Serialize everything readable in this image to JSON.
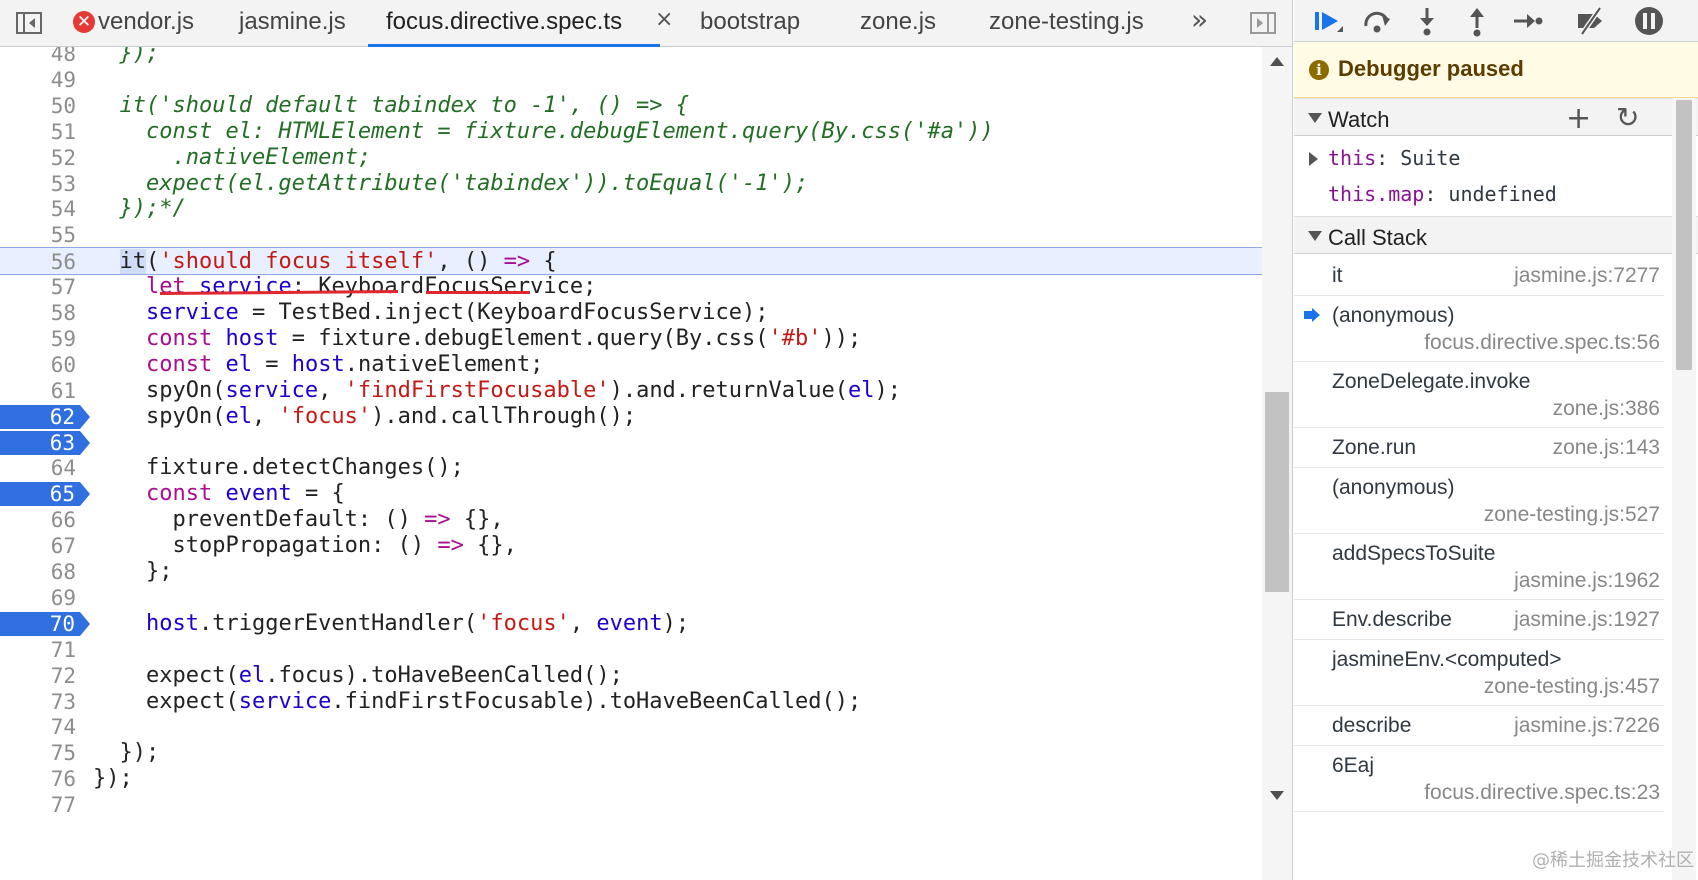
{
  "tabs": [
    {
      "label": "vendor.js",
      "error": true
    },
    {
      "label": "jasmine.js"
    },
    {
      "label": "focus.directive.spec.ts",
      "active": true
    },
    {
      "label": "bootstrap"
    },
    {
      "label": "zone.js"
    },
    {
      "label": "zone-testing.js"
    }
  ],
  "icons": {
    "tab_error": "✕",
    "tab_close": "×",
    "more": "»"
  },
  "code": {
    "lines": [
      {
        "n": "48",
        "text": "  });"
      },
      {
        "n": "49",
        "text": ""
      },
      {
        "n": "50",
        "text": "  it('should default tabindex to -1', () => {"
      },
      {
        "n": "51",
        "text": "    const el: HTMLElement = fixture.debugElement.query(By.css('#a'))"
      },
      {
        "n": "52",
        "text": "      .nativeElement;"
      },
      {
        "n": "53",
        "text": "    expect(el.getAttribute('tabindex')).toEqual('-1');"
      },
      {
        "n": "54",
        "text": "  });*/"
      },
      {
        "n": "55",
        "text": ""
      },
      {
        "n": "56",
        "text": "  it('should focus itself', () => {"
      },
      {
        "n": "57",
        "text": "    let service: KeyboardFocusService;"
      },
      {
        "n": "58",
        "text": "    service = TestBed.inject(KeyboardFocusService);"
      },
      {
        "n": "59",
        "text": "    const host = fixture.debugElement.query(By.css('#b'));"
      },
      {
        "n": "60",
        "text": "    const el = host.nativeElement;"
      },
      {
        "n": "61",
        "text": "    spyOn(service, 'findFirstFocusable').and.returnValue(el);"
      },
      {
        "n": "62",
        "text": "    spyOn(el, 'focus').and.callThrough();"
      },
      {
        "n": "63",
        "text": ""
      },
      {
        "n": "64",
        "text": "    fixture.detectChanges();"
      },
      {
        "n": "65",
        "text": "    const event = {"
      },
      {
        "n": "66",
        "text": "      preventDefault: () => {},"
      },
      {
        "n": "67",
        "text": "      stopPropagation: () => {},"
      },
      {
        "n": "68",
        "text": "    };"
      },
      {
        "n": "69",
        "text": ""
      },
      {
        "n": "70",
        "text": "    host.triggerEventHandler('focus', event);"
      },
      {
        "n": "71",
        "text": ""
      },
      {
        "n": "72",
        "text": "    expect(el.focus).toHaveBeenCalled();"
      },
      {
        "n": "73",
        "text": "    expect(service.findFirstFocusable).toHaveBeenCalled();"
      },
      {
        "n": "74",
        "text": ""
      },
      {
        "n": "75",
        "text": "  });"
      },
      {
        "n": "76",
        "text": "});"
      },
      {
        "n": "77",
        "text": ""
      }
    ],
    "breakpoints": [
      "62",
      "63",
      "65",
      "70"
    ],
    "current_line": "56"
  },
  "debugger": {
    "status": "Debugger paused",
    "watch": {
      "title": "Watch",
      "add_icon": "+",
      "refresh_icon": "↻",
      "items": [
        {
          "key": "this",
          "sep": ": ",
          "value": "Suite",
          "expandable": true
        },
        {
          "key": "this.map",
          "sep": ": ",
          "value": "undefined",
          "expandable": false
        }
      ]
    },
    "call_stack": {
      "title": "Call Stack",
      "frames": [
        {
          "name": "it",
          "location": "jasmine.js:7277"
        },
        {
          "name": "(anonymous)",
          "location": "focus.directive.spec.ts:56",
          "current": true
        },
        {
          "name": "ZoneDelegate.invoke",
          "location": "zone.js:386"
        },
        {
          "name": "Zone.run",
          "location": "zone.js:143"
        },
        {
          "name": "(anonymous)",
          "location": "zone-testing.js:527"
        },
        {
          "name": "addSpecsToSuite",
          "location": "jasmine.js:1962"
        },
        {
          "name": "Env.describe",
          "location": "jasmine.js:1927"
        },
        {
          "name": "jasmineEnv.<computed>",
          "location": "zone-testing.js:457"
        },
        {
          "name": "describe",
          "location": "jasmine.js:7226"
        },
        {
          "name": "6Eaj",
          "location": "focus.directive.spec.ts:23"
        }
      ]
    }
  },
  "watermark": "@稀土掘金技术社区"
}
